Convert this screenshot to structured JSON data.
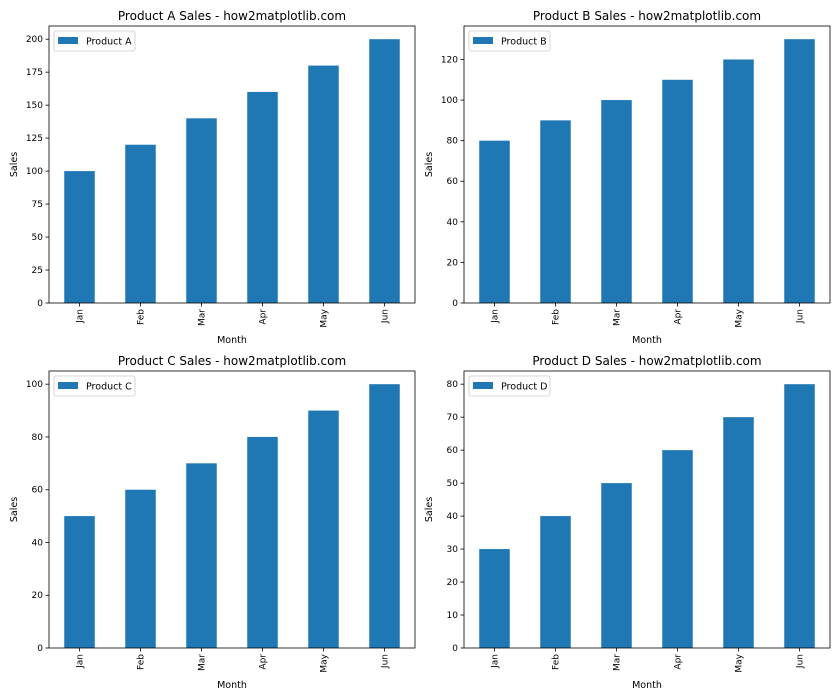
{
  "chart_data": [
    {
      "type": "bar",
      "title": "Product A Sales - how2matplotlib.com",
      "xlabel": "Month",
      "ylabel": "Sales",
      "categories": [
        "Jan",
        "Feb",
        "Mar",
        "Apr",
        "May",
        "Jun"
      ],
      "series": [
        {
          "name": "Product A",
          "values": [
            100,
            120,
            140,
            160,
            180,
            200
          ]
        }
      ],
      "ylim": [
        0,
        210
      ],
      "yticks": [
        0,
        25,
        50,
        75,
        100,
        125,
        150,
        175,
        200
      ],
      "legend": "top-left",
      "grid": false,
      "color": "#1f77b4"
    },
    {
      "type": "bar",
      "title": "Product B Sales - how2matplotlib.com",
      "xlabel": "Month",
      "ylabel": "Sales",
      "categories": [
        "Jan",
        "Feb",
        "Mar",
        "Apr",
        "May",
        "Jun"
      ],
      "series": [
        {
          "name": "Product B",
          "values": [
            80,
            90,
            100,
            110,
            120,
            130
          ]
        }
      ],
      "ylim": [
        0,
        136.5
      ],
      "yticks": [
        0,
        20,
        40,
        60,
        80,
        100,
        120
      ],
      "legend": "top-left",
      "grid": false,
      "color": "#1f77b4"
    },
    {
      "type": "bar",
      "title": "Product C Sales - how2matplotlib.com",
      "xlabel": "Month",
      "ylabel": "Sales",
      "categories": [
        "Jan",
        "Feb",
        "Mar",
        "Apr",
        "May",
        "Jun"
      ],
      "series": [
        {
          "name": "Product C",
          "values": [
            50,
            60,
            70,
            80,
            90,
            100
          ]
        }
      ],
      "ylim": [
        0,
        105
      ],
      "yticks": [
        0,
        20,
        40,
        60,
        80,
        100
      ],
      "legend": "top-left",
      "grid": false,
      "color": "#1f77b4"
    },
    {
      "type": "bar",
      "title": "Product D Sales - how2matplotlib.com",
      "xlabel": "Month",
      "ylabel": "Sales",
      "categories": [
        "Jan",
        "Feb",
        "Mar",
        "Apr",
        "May",
        "Jun"
      ],
      "series": [
        {
          "name": "Product D",
          "values": [
            30,
            40,
            50,
            60,
            70,
            80
          ]
        }
      ],
      "ylim": [
        0,
        84
      ],
      "yticks": [
        0,
        10,
        20,
        30,
        40,
        50,
        60,
        70,
        80
      ],
      "legend": "top-left",
      "grid": false,
      "color": "#1f77b4"
    }
  ]
}
